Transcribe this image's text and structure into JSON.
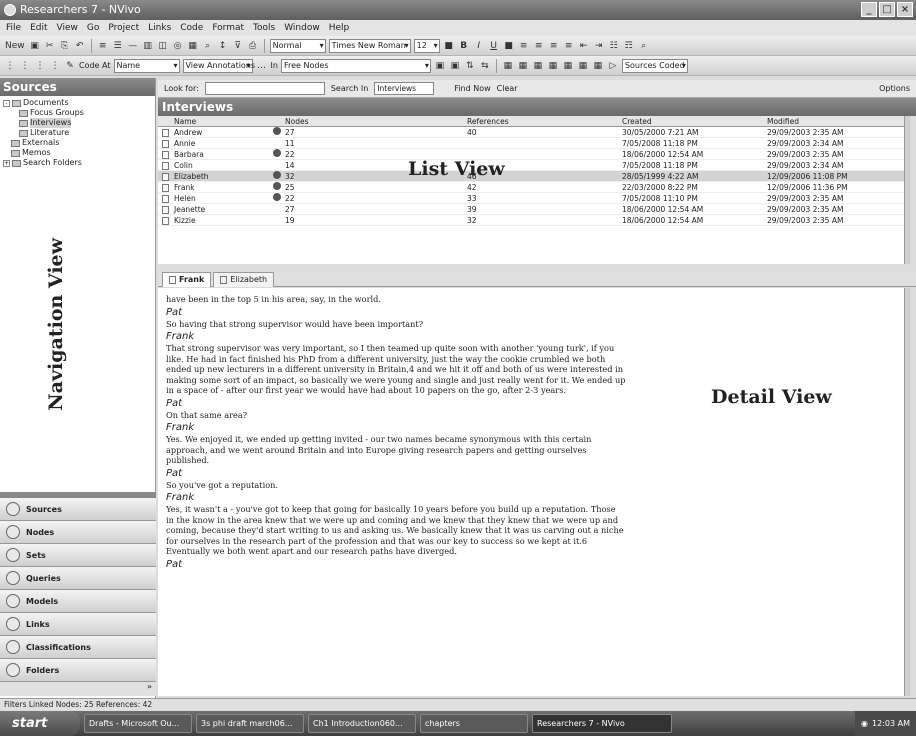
{
  "window": {
    "title": "Researchers 7 - NVivo"
  },
  "menu": [
    "File",
    "Edit",
    "View",
    "Go",
    "Project",
    "Links",
    "Code",
    "Format",
    "Tools",
    "Window",
    "Help"
  ],
  "toolbar1": {
    "new_label": "New",
    "style": "Normal",
    "font": "Times New Roman",
    "size": "12"
  },
  "toolbar2": {
    "code_at_label": "Code At",
    "name_combo": "Name",
    "in_label": "In",
    "annotations_combo": "View Annotations",
    "free_nodes": "Free Nodes",
    "sources_coded": "Sources Coded"
  },
  "sidebar": {
    "title": "Sources",
    "tree": [
      {
        "label": "Documents",
        "level": 0
      },
      {
        "label": "Focus Groups",
        "level": 1
      },
      {
        "label": "Interviews",
        "level": 1
      },
      {
        "label": "Literature",
        "level": 1
      },
      {
        "label": "Externals",
        "level": 0
      },
      {
        "label": "Memos",
        "level": 0
      },
      {
        "label": "Search Folders",
        "level": 0
      }
    ],
    "nav_buttons": [
      "Sources",
      "Nodes",
      "Sets",
      "Queries",
      "Models",
      "Links",
      "Classifications",
      "Folders"
    ]
  },
  "nav_view_label": "Navigation View",
  "findbar": {
    "look_for": "Look for:",
    "search_in": "Search In",
    "search_in_value": "Interviews",
    "find_now": "Find Now",
    "clear": "Clear",
    "options": "Options"
  },
  "list": {
    "title": "Interviews",
    "columns": [
      "Name",
      "Nodes",
      "References",
      "Created",
      "Modified"
    ],
    "rows": [
      {
        "name": "Andrew",
        "linked": true,
        "nodes": "27",
        "refs": "40",
        "created": "30/05/2000 7:21 AM",
        "modified": "29/09/2003 2:35 AM"
      },
      {
        "name": "Annie",
        "linked": false,
        "nodes": "11",
        "refs": "",
        "created": "7/05/2008 11:18 PM",
        "modified": "29/09/2003 2:34 AM"
      },
      {
        "name": "Barbara",
        "linked": true,
        "nodes": "22",
        "refs": "",
        "created": "18/06/2000 12:54 AM",
        "modified": "29/09/2003 2:35 AM"
      },
      {
        "name": "Colin",
        "linked": false,
        "nodes": "14",
        "refs": "",
        "created": "7/05/2008 11:18 PM",
        "modified": "29/09/2003 2:34 AM"
      },
      {
        "name": "Elizabeth",
        "linked": true,
        "nodes": "32",
        "refs": "46",
        "created": "28/05/1999 4:22 AM",
        "modified": "12/09/2006 11:08 PM",
        "selected": true
      },
      {
        "name": "Frank",
        "linked": true,
        "nodes": "25",
        "refs": "42",
        "created": "22/03/2000 8:22 PM",
        "modified": "12/09/2006 11:36 PM"
      },
      {
        "name": "Helen",
        "linked": true,
        "nodes": "22",
        "refs": "33",
        "created": "7/05/2008 11:10 PM",
        "modified": "29/09/2003 2:35 AM"
      },
      {
        "name": "Jeanette",
        "linked": false,
        "nodes": "27",
        "refs": "39",
        "created": "18/06/2000 12:54 AM",
        "modified": "29/09/2003 2:35 AM"
      },
      {
        "name": "Kizzie",
        "linked": false,
        "nodes": "19",
        "refs": "32",
        "created": "18/06/2000 12:54 AM",
        "modified": "29/09/2003 2:35 AM"
      }
    ]
  },
  "list_view_label": "List View",
  "tabs": [
    "Frank",
    "Elizabeth"
  ],
  "detail": [
    {
      "type": "text",
      "text": "have been in the top 5 in his area, say, in the world."
    },
    {
      "type": "speaker",
      "text": "Pat"
    },
    {
      "type": "text",
      "text": "So having that strong supervisor would have been important?"
    },
    {
      "type": "speaker",
      "text": "Frank"
    },
    {
      "type": "text",
      "text": "That strong supervisor was very important, so I then teamed up quite soon with another 'young turk', if you like. He had in fact finished his PhD from a different university, just the way the cookie crumbled we both ended up new lecturers in a different university in Britain,4 and we hit it off and both of us were interested in making some sort of an impact, so basically we were young and single and just really went for it. We ended up in a space of - after our first year we would have had about 10 papers on the go, after 2-3 years."
    },
    {
      "type": "speaker",
      "text": "Pat"
    },
    {
      "type": "text",
      "text": "On that same area?"
    },
    {
      "type": "speaker",
      "text": "Frank"
    },
    {
      "type": "text",
      "text": "Yes. We enjoyed it, we ended up getting invited - our two names became synonymous with this certain approach, and we went around Britain and into Europe giving research papers and getting ourselves published."
    },
    {
      "type": "speaker",
      "text": "Pat"
    },
    {
      "type": "text",
      "text": "So you've got a reputation."
    },
    {
      "type": "speaker",
      "text": "Frank"
    },
    {
      "type": "text",
      "text": "Yes, it wasn't a - you've got to keep that going for basically 10 years before you build up a reputation. Those in the know in the area knew that we were up and coming and we knew that they knew that we were up and coming, because they'd start writing to us and asking us. We basically knew that it was us carving out a niche for ourselves in the research part of the profession and that was our key to success so we kept at it.6 Eventually we both went apart and our research paths have diverged."
    },
    {
      "type": "speaker",
      "text": "Pat"
    }
  ],
  "detail_view_label": "Detail View",
  "status": "Filters  Linked  Nodes: 25  References: 42",
  "taskbar": {
    "start": "start",
    "tasks": [
      "Drafts - Microsoft Ou...",
      "3s phi draft march06...",
      "Ch1 Introduction060...",
      "chapters",
      "Researchers 7 - NVivo"
    ],
    "clock": "12:03 AM"
  }
}
